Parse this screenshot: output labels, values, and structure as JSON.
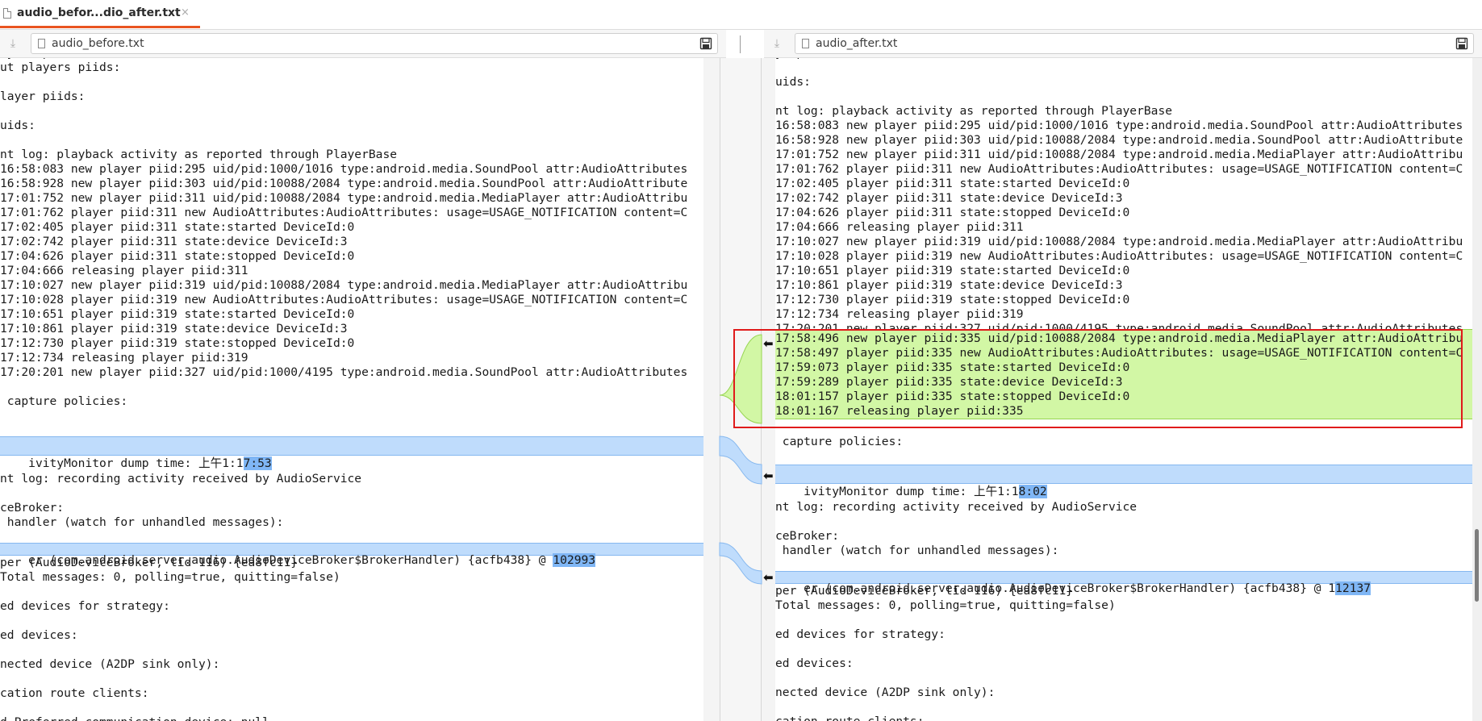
{
  "tab": {
    "title": "audio_befor...dio_after.txt",
    "close": "×"
  },
  "left_path": "audio_before.txt",
  "right_path": "audio_after.txt",
  "icons": {
    "download": "download-icon",
    "file": "file-icon",
    "save": "save-icon",
    "arrow_push": "arrow-right-icon",
    "arrow_pull": "arrow-left-icon"
  },
  "colors": {
    "changed_bg": "#bfdcfc",
    "changed_word": "#7fb6f5",
    "inserted_bg": "#d2f7a5",
    "tab_accent": "#e95420",
    "annotation": "#e01b1b"
  },
  "left_lines": [
    "ayers piids:",
    "ut players piids:",
    "",
    "layer piids:",
    "",
    "uids:",
    "",
    "nt log: playback activity as reported through PlayerBase",
    "16:58:083 new player piid:295 uid/pid:1000/1016 type:android.media.SoundPool attr:AudioAttributes",
    "16:58:928 new player piid:303 uid/pid:10088/2084 type:android.media.SoundPool attr:AudioAttribute",
    "17:01:752 new player piid:311 uid/pid:10088/2084 type:android.media.MediaPlayer attr:AudioAttribu",
    "17:01:762 player piid:311 new AudioAttributes:AudioAttributes: usage=USAGE_NOTIFICATION content=C",
    "17:02:405 player piid:311 state:started DeviceId:0",
    "17:02:742 player piid:311 state:device DeviceId:3",
    "17:04:626 player piid:311 state:stopped DeviceId:0",
    "17:04:666 releasing player piid:311",
    "17:10:027 new player piid:319 uid/pid:10088/2084 type:android.media.MediaPlayer attr:AudioAttribu",
    "17:10:028 player piid:319 new AudioAttributes:AudioAttributes: usage=USAGE_NOTIFICATION content=C",
    "17:10:651 player piid:319 state:started DeviceId:0",
    "17:10:861 player piid:319 state:device DeviceId:3",
    "17:12:730 player piid:319 state:stopped DeviceId:0",
    "17:12:734 releasing player piid:319",
    "17:20:201 new player piid:327 uid/pid:1000/4195 type:android.media.SoundPool attr:AudioAttributes",
    "",
    " capture policies:",
    ""
  ],
  "left_dump": {
    "prefix": "ivityMonitor dump time: 上午1:1",
    "changed": "7:53"
  },
  "left_lines2": [
    "",
    "nt log: recording activity received by AudioService",
    "",
    "ceBroker:",
    " handler (watch for unhandled messages):"
  ],
  "left_broker": {
    "prefix": "er (com.android.server.audio.AudioDeviceBroker$BrokerHandler) {acfb438} @ ",
    "changed": "102993"
  },
  "left_lines3": [
    "per (AudioDeviceBroker, tid 116) {ea8fc11}",
    "Total messages: 0, polling=true, quitting=false)",
    "",
    "ed devices for strategy:",
    "",
    "ed devices:",
    "",
    "nected device (A2DP sink only):",
    "",
    "cation route clients:",
    "",
    "d Preferred communication device: null"
  ],
  "right_lines": [
    "y  p",
    "",
    "uids:",
    "",
    "nt log: playback activity as reported through PlayerBase",
    "16:58:083 new player piid:295 uid/pid:1000/1016 type:android.media.SoundPool attr:AudioAttributes",
    "16:58:928 new player piid:303 uid/pid:10088/2084 type:android.media.SoundPool attr:AudioAttribute",
    "17:01:752 new player piid:311 uid/pid:10088/2084 type:android.media.MediaPlayer attr:AudioAttribu",
    "17:01:762 player piid:311 new AudioAttributes:AudioAttributes: usage=USAGE_NOTIFICATION content=C",
    "17:02:405 player piid:311 state:started DeviceId:0",
    "17:02:742 player piid:311 state:device DeviceId:3",
    "17:04:626 player piid:311 state:stopped DeviceId:0",
    "17:04:666 releasing player piid:311",
    "17:10:027 new player piid:319 uid/pid:10088/2084 type:android.media.MediaPlayer attr:AudioAttribu",
    "17:10:028 player piid:319 new AudioAttributes:AudioAttributes: usage=USAGE_NOTIFICATION content=C",
    "17:10:651 player piid:319 state:started DeviceId:0",
    "17:10:861 player piid:319 state:device DeviceId:3",
    "17:12:730 player piid:319 state:stopped DeviceId:0",
    "17:12:734 releasing player piid:319",
    "17:20:201 new player piid:327 uid/pid:1000/4195 type:android.media.SoundPool attr:AudioAttributes"
  ],
  "right_inserted": [
    "17:58:496 new player piid:335 uid/pid:10088/2084 type:android.media.MediaPlayer attr:AudioAttribu",
    "17:58:497 player piid:335 new AudioAttributes:AudioAttributes: usage=USAGE_NOTIFICATION content=C",
    "17:59:073 player piid:335 state:started DeviceId:0",
    "17:59:289 player piid:335 state:device DeviceId:3",
    "18:01:157 player piid:335 state:stopped DeviceId:0",
    "18:01:167 releasing player piid:335"
  ],
  "right_lines_b": [
    "",
    " capture policies:",
    ""
  ],
  "right_dump": {
    "prefix": "ivityMonitor dump time: 上午1:1",
    "changed": "8:02"
  },
  "right_lines2": [
    "",
    "nt log: recording activity received by AudioService",
    "",
    "ceBroker:",
    " handler (watch for unhandled messages):"
  ],
  "right_broker": {
    "prefix": "er (com.android.server.audio.AudioDeviceBroker$BrokerHandler) {acfb438} @ 1",
    "changed": "12137"
  },
  "right_lines3": [
    "per (AudioDeviceBroker, tid 116) {ea8fc11}",
    "Total messages: 0, polling=true, quitting=false)",
    "",
    "ed devices for strategy:",
    "",
    "ed devices:",
    "",
    "nected device (A2DP sink only):",
    "",
    "cation route clients:"
  ]
}
